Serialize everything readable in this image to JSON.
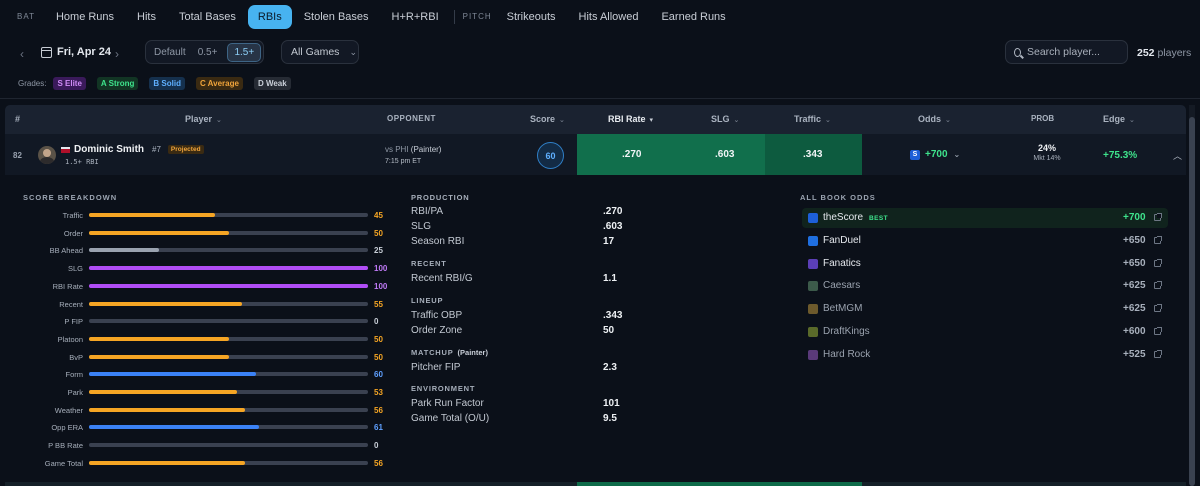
{
  "tabs": {
    "bat_label": "BAT",
    "pitch_label": "PITCH",
    "bat": [
      "Home Runs",
      "Hits",
      "Total Bases",
      "RBIs",
      "Stolen Bases",
      "H+R+RBI"
    ],
    "pitch": [
      "Strikeouts",
      "Hits Allowed",
      "Earned Runs"
    ],
    "active": "RBIs"
  },
  "controls": {
    "date": "Fri, Apr 24",
    "thresholds": [
      "Default",
      "0.5+",
      "1.5+"
    ],
    "threshold_active": "1.5+",
    "games_filter": "All Games",
    "search_placeholder": "Search player...",
    "player_count": "252",
    "player_count_suffix": "players"
  },
  "grades": {
    "label": "Grades:",
    "items": [
      {
        "label": "S Elite",
        "bg": "#3a1a5a",
        "fg": "#d08cf7"
      },
      {
        "label": "A Strong",
        "bg": "#123524",
        "fg": "#3ee38c"
      },
      {
        "label": "B Solid",
        "bg": "#15304d",
        "fg": "#5fb0ff"
      },
      {
        "label": "C Average",
        "bg": "#3a2a12",
        "fg": "#f0a43b"
      },
      {
        "label": "D Weak",
        "bg": "#262b34",
        "fg": "#c9cfd8"
      }
    ]
  },
  "table": {
    "headers": {
      "rank": "#",
      "player": "Player",
      "opponent": "OPPONENT",
      "score": "Score",
      "rbi_rate": "RBI Rate",
      "slg": "SLG",
      "traffic": "Traffic",
      "odds": "Odds",
      "prob": "PROB",
      "edge": "Edge"
    }
  },
  "player": {
    "rank": "82",
    "name": "Dominic Smith",
    "jersey": "#7",
    "tag": "Projected",
    "line": "1.5+ RBI",
    "opponent_prefix": "vs PHI",
    "opponent_pitcher": "(Painter)",
    "time": "7:15 pm ET",
    "score": "60",
    "rbi_rate": ".270",
    "slg": ".603",
    "traffic": ".343",
    "odds": "+700",
    "prob": "24%",
    "mkt": "Mkt 14%",
    "edge": "+75.3%"
  },
  "breakdown": {
    "title": "SCORE BREAKDOWN",
    "rows": [
      {
        "label": "Traffic",
        "value": 45,
        "color": "#f5a524"
      },
      {
        "label": "Order",
        "value": 50,
        "color": "#f5a524"
      },
      {
        "label": "BB Ahead",
        "value": 25,
        "color": "#9aa3b0"
      },
      {
        "label": "SLG",
        "value": 100,
        "color": "#b04df5"
      },
      {
        "label": "RBI Rate",
        "value": 100,
        "color": "#b04df5"
      },
      {
        "label": "Recent",
        "value": 55,
        "color": "#f5a524"
      },
      {
        "label": "P FIP",
        "value": 0,
        "color": "#9aa3b0"
      },
      {
        "label": "Platoon",
        "value": 50,
        "color": "#f5a524"
      },
      {
        "label": "BvP",
        "value": 50,
        "color": "#f5a524"
      },
      {
        "label": "Form",
        "value": 60,
        "color": "#3b82f6"
      },
      {
        "label": "Park",
        "value": 53,
        "color": "#f5a524"
      },
      {
        "label": "Weather",
        "value": 56,
        "color": "#f5a524"
      },
      {
        "label": "Opp ERA",
        "value": 61,
        "color": "#3b82f6"
      },
      {
        "label": "P BB Rate",
        "value": 0,
        "color": "#9aa3b0"
      },
      {
        "label": "Game Total",
        "value": 56,
        "color": "#f5a524"
      }
    ]
  },
  "stats": {
    "production_title": "PRODUCTION",
    "rbi_pa_label": "RBI/PA",
    "rbi_pa": ".270",
    "slg_label": "SLG",
    "slg": ".603",
    "season_rbi_label": "Season RBI",
    "season_rbi": "17",
    "recent_title": "RECENT",
    "recent_label": "Recent RBI/G",
    "recent": "1.1",
    "lineup_title": "LINEUP",
    "traffic_label": "Traffic OBP",
    "traffic": ".343",
    "order_label": "Order Zone",
    "order": "50",
    "matchup_title": "MATCHUP",
    "matchup_pitcher": "(Painter)",
    "fip_label": "Pitcher FIP",
    "fip": "2.3",
    "env_title": "ENVIRONMENT",
    "park_label": "Park Run Factor",
    "park": "101",
    "total_label": "Game Total (O/U)",
    "total": "9.5"
  },
  "books": {
    "title": "ALL BOOK ODDS",
    "best_label": "BEST",
    "items": [
      {
        "name": "theScore",
        "odds": "+700",
        "logo": "#1d5fd8"
      },
      {
        "name": "FanDuel",
        "odds": "+650",
        "logo": "#1f6fe0"
      },
      {
        "name": "Fanatics",
        "odds": "+650",
        "logo": "#5b3fb7"
      },
      {
        "name": "Caesars",
        "odds": "+625",
        "logo": "#3c5a4a"
      },
      {
        "name": "BetMGM",
        "odds": "+625",
        "logo": "#6d5a2c"
      },
      {
        "name": "DraftKings",
        "odds": "+600",
        "logo": "#5a6a2a"
      },
      {
        "name": "Hard Rock",
        "odds": "+525",
        "logo": "#5a3a7a"
      }
    ]
  }
}
